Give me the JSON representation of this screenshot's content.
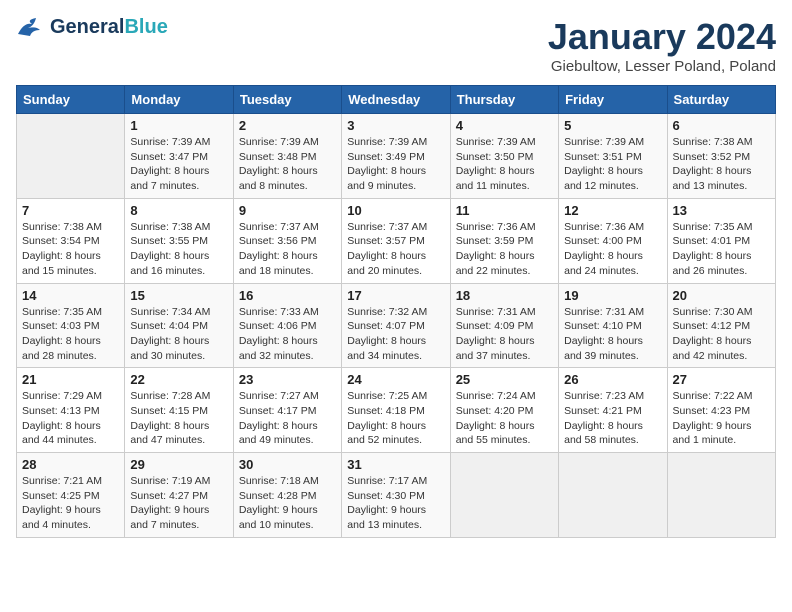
{
  "header": {
    "logo_line1": "General",
    "logo_line2": "Blue",
    "month": "January 2024",
    "location": "Giebultow, Lesser Poland, Poland"
  },
  "days_of_week": [
    "Sunday",
    "Monday",
    "Tuesday",
    "Wednesday",
    "Thursday",
    "Friday",
    "Saturday"
  ],
  "weeks": [
    [
      {
        "day": "",
        "sunrise": "",
        "sunset": "",
        "daylight": ""
      },
      {
        "day": "1",
        "sunrise": "Sunrise: 7:39 AM",
        "sunset": "Sunset: 3:47 PM",
        "daylight": "Daylight: 8 hours and 7 minutes."
      },
      {
        "day": "2",
        "sunrise": "Sunrise: 7:39 AM",
        "sunset": "Sunset: 3:48 PM",
        "daylight": "Daylight: 8 hours and 8 minutes."
      },
      {
        "day": "3",
        "sunrise": "Sunrise: 7:39 AM",
        "sunset": "Sunset: 3:49 PM",
        "daylight": "Daylight: 8 hours and 9 minutes."
      },
      {
        "day": "4",
        "sunrise": "Sunrise: 7:39 AM",
        "sunset": "Sunset: 3:50 PM",
        "daylight": "Daylight: 8 hours and 11 minutes."
      },
      {
        "day": "5",
        "sunrise": "Sunrise: 7:39 AM",
        "sunset": "Sunset: 3:51 PM",
        "daylight": "Daylight: 8 hours and 12 minutes."
      },
      {
        "day": "6",
        "sunrise": "Sunrise: 7:38 AM",
        "sunset": "Sunset: 3:52 PM",
        "daylight": "Daylight: 8 hours and 13 minutes."
      }
    ],
    [
      {
        "day": "7",
        "sunrise": "Sunrise: 7:38 AM",
        "sunset": "Sunset: 3:54 PM",
        "daylight": "Daylight: 8 hours and 15 minutes."
      },
      {
        "day": "8",
        "sunrise": "Sunrise: 7:38 AM",
        "sunset": "Sunset: 3:55 PM",
        "daylight": "Daylight: 8 hours and 16 minutes."
      },
      {
        "day": "9",
        "sunrise": "Sunrise: 7:37 AM",
        "sunset": "Sunset: 3:56 PM",
        "daylight": "Daylight: 8 hours and 18 minutes."
      },
      {
        "day": "10",
        "sunrise": "Sunrise: 7:37 AM",
        "sunset": "Sunset: 3:57 PM",
        "daylight": "Daylight: 8 hours and 20 minutes."
      },
      {
        "day": "11",
        "sunrise": "Sunrise: 7:36 AM",
        "sunset": "Sunset: 3:59 PM",
        "daylight": "Daylight: 8 hours and 22 minutes."
      },
      {
        "day": "12",
        "sunrise": "Sunrise: 7:36 AM",
        "sunset": "Sunset: 4:00 PM",
        "daylight": "Daylight: 8 hours and 24 minutes."
      },
      {
        "day": "13",
        "sunrise": "Sunrise: 7:35 AM",
        "sunset": "Sunset: 4:01 PM",
        "daylight": "Daylight: 8 hours and 26 minutes."
      }
    ],
    [
      {
        "day": "14",
        "sunrise": "Sunrise: 7:35 AM",
        "sunset": "Sunset: 4:03 PM",
        "daylight": "Daylight: 8 hours and 28 minutes."
      },
      {
        "day": "15",
        "sunrise": "Sunrise: 7:34 AM",
        "sunset": "Sunset: 4:04 PM",
        "daylight": "Daylight: 8 hours and 30 minutes."
      },
      {
        "day": "16",
        "sunrise": "Sunrise: 7:33 AM",
        "sunset": "Sunset: 4:06 PM",
        "daylight": "Daylight: 8 hours and 32 minutes."
      },
      {
        "day": "17",
        "sunrise": "Sunrise: 7:32 AM",
        "sunset": "Sunset: 4:07 PM",
        "daylight": "Daylight: 8 hours and 34 minutes."
      },
      {
        "day": "18",
        "sunrise": "Sunrise: 7:31 AM",
        "sunset": "Sunset: 4:09 PM",
        "daylight": "Daylight: 8 hours and 37 minutes."
      },
      {
        "day": "19",
        "sunrise": "Sunrise: 7:31 AM",
        "sunset": "Sunset: 4:10 PM",
        "daylight": "Daylight: 8 hours and 39 minutes."
      },
      {
        "day": "20",
        "sunrise": "Sunrise: 7:30 AM",
        "sunset": "Sunset: 4:12 PM",
        "daylight": "Daylight: 8 hours and 42 minutes."
      }
    ],
    [
      {
        "day": "21",
        "sunrise": "Sunrise: 7:29 AM",
        "sunset": "Sunset: 4:13 PM",
        "daylight": "Daylight: 8 hours and 44 minutes."
      },
      {
        "day": "22",
        "sunrise": "Sunrise: 7:28 AM",
        "sunset": "Sunset: 4:15 PM",
        "daylight": "Daylight: 8 hours and 47 minutes."
      },
      {
        "day": "23",
        "sunrise": "Sunrise: 7:27 AM",
        "sunset": "Sunset: 4:17 PM",
        "daylight": "Daylight: 8 hours and 49 minutes."
      },
      {
        "day": "24",
        "sunrise": "Sunrise: 7:25 AM",
        "sunset": "Sunset: 4:18 PM",
        "daylight": "Daylight: 8 hours and 52 minutes."
      },
      {
        "day": "25",
        "sunrise": "Sunrise: 7:24 AM",
        "sunset": "Sunset: 4:20 PM",
        "daylight": "Daylight: 8 hours and 55 minutes."
      },
      {
        "day": "26",
        "sunrise": "Sunrise: 7:23 AM",
        "sunset": "Sunset: 4:21 PM",
        "daylight": "Daylight: 8 hours and 58 minutes."
      },
      {
        "day": "27",
        "sunrise": "Sunrise: 7:22 AM",
        "sunset": "Sunset: 4:23 PM",
        "daylight": "Daylight: 9 hours and 1 minute."
      }
    ],
    [
      {
        "day": "28",
        "sunrise": "Sunrise: 7:21 AM",
        "sunset": "Sunset: 4:25 PM",
        "daylight": "Daylight: 9 hours and 4 minutes."
      },
      {
        "day": "29",
        "sunrise": "Sunrise: 7:19 AM",
        "sunset": "Sunset: 4:27 PM",
        "daylight": "Daylight: 9 hours and 7 minutes."
      },
      {
        "day": "30",
        "sunrise": "Sunrise: 7:18 AM",
        "sunset": "Sunset: 4:28 PM",
        "daylight": "Daylight: 9 hours and 10 minutes."
      },
      {
        "day": "31",
        "sunrise": "Sunrise: 7:17 AM",
        "sunset": "Sunset: 4:30 PM",
        "daylight": "Daylight: 9 hours and 13 minutes."
      },
      {
        "day": "",
        "sunrise": "",
        "sunset": "",
        "daylight": ""
      },
      {
        "day": "",
        "sunrise": "",
        "sunset": "",
        "daylight": ""
      },
      {
        "day": "",
        "sunrise": "",
        "sunset": "",
        "daylight": ""
      }
    ]
  ]
}
